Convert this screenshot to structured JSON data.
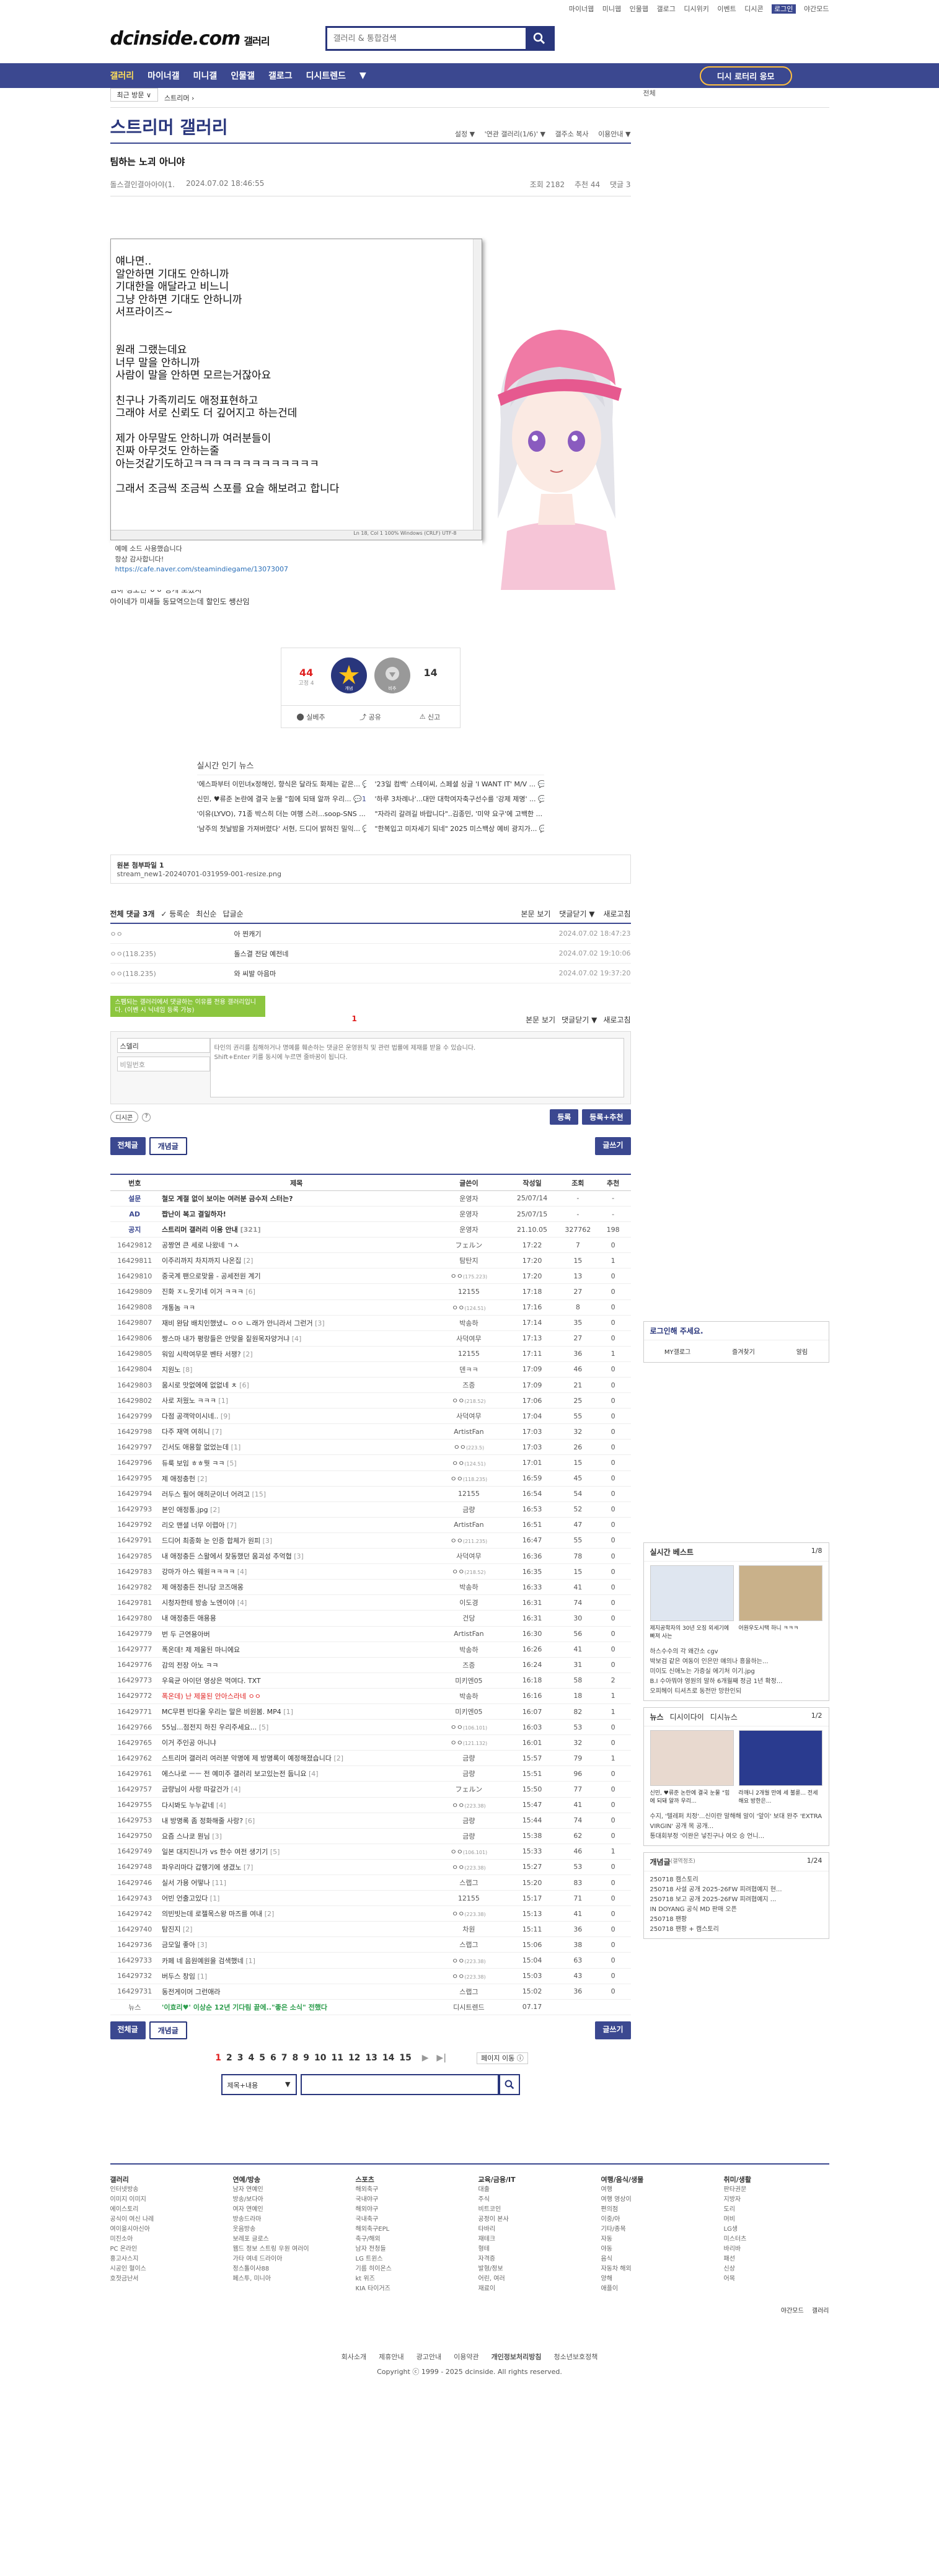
{
  "util": [
    "마이너웹",
    "미니웹",
    "인물웹",
    "갤로그",
    "디시위키",
    "이벤트",
    "디시콘",
    "로그인",
    "야간모드"
  ],
  "logo": {
    "main": "dcinside.com",
    "sub": "갤러리"
  },
  "search": {
    "placeholder": "갤러리 & 통합검색"
  },
  "nav": {
    "items": [
      "갤러리",
      "마이너갤",
      "미니갤",
      "인물갤",
      "갤로그",
      "디시트렌드",
      "▼"
    ],
    "cta": "디시 로터리 응모"
  },
  "crumb": {
    "box": "최근 방문 ∨",
    "path": "스트리머 ›",
    "right": "전체"
  },
  "gallery": {
    "title": "스트리머 갤러리",
    "tools": [
      "설정 ▼",
      "'연관 갤러리(1/6)' ▼",
      "갤주소 복사",
      "이용안내 ▼"
    ]
  },
  "post": {
    "title": "팀하는 노괴 아니야",
    "author": "돌스결인결아아야(1.",
    "date": "2024.07.02 18:46:55",
    "views": "조회 2182",
    "likes": "추천 44",
    "comments": "댓글 3"
  },
  "note": "얘나면..\n알안하면 기대도 안하니까\n기대한을 애달라고 비느니\n그냥 안하면 기대도 안하니까\n서프라이즈~\n\n\n원래 그랬는데요\n너무 말을 안하니까\n사람이 말을 안하면 모르는거잖아요\n\n친구나 가족끼리도 애정표현하고\n그래야 서로 신뢰도 더 깊어지고 하는건데\n\n제가 아무말도 안하니까 여러분들이\n진짜 아무것도 안하는줄\n아는것같기도하고ㅋㅋㅋㅋㅋㅋㅋㅋㅋㅋㅋㅋㅋ\n\n그래서 조금씩 조금씩 스포를 요슬 해보려고 합니다",
  "note_status": "Ln 18, Col 1    100%    Windows (CRLF)    UTF-8",
  "below": [
    "예메 소드 사용했습니다",
    "항상 감사합니다!"
  ],
  "below_link": "https://cafe.naver.com/steamindiegame/13073007",
  "body": [
    "팀하 정도면 ㅎㅎ 공개 보겠지",
    "아이네가 미새들 동묘역으는데 할인도 쌩산임"
  ],
  "vote": {
    "up": "44",
    "up_sub": "고정 4",
    "down": "14",
    "up_label": "개념",
    "down_label": "비추",
    "acts": [
      "실베추",
      "공유",
      "신고"
    ]
  },
  "news": {
    "title": "실시간 인기 뉴스",
    "items": [
      {
        "t": "'에스파부터 이민녀x정해인, 향식은 달라도 화제는 같은...",
        "c": "0"
      },
      {
        "t": "'23일 컴백' 스테이씨, 스페셜 싱글 'I WANT IT' M/V ...",
        "c": "0"
      },
      {
        "t": "신민, ♥류준 논란에 결국 눈물 \"힘에 되돼 알까 우리...",
        "c": "1"
      },
      {
        "t": "'하루 3차례나'...대만 대학여자축구선수를 '강제 제명' ...",
        "c": "1"
      },
      {
        "t": "'이유(LYVO), 71종 박스히 더는 여행 스러...soop-SNS ...",
        "c": "41"
      },
      {
        "t": "\"자라리 갈려길 바랍니다\"..김종민, '미약 요구'에 고백한 ...",
        "c": "0"
      },
      {
        "t": "'남주의 첫날밤을 가져버렸다' 서현, 드디어 밝혀진 밀익...",
        "c": "0"
      },
      {
        "t": "\"한복입고 미자세기 되네\" 2025 미스백상 예비 광지가...",
        "c": "97"
      }
    ]
  },
  "files": {
    "label": "원본 첨부파일 1",
    "name": "stream_new1-20240701-031959-001-resize.png"
  },
  "cmthead": {
    "left": "전체 댓글 3개",
    "opts": [
      "✓ 등록순",
      "최신순",
      "답글순"
    ],
    "right": [
      "본문 보기",
      "댓글닫기 ▼",
      "새로고침"
    ]
  },
  "cmts": [
    {
      "n": "ㅇㅇ",
      "t": "아 찐캐기",
      "d": "2024.07.02 18:47:23"
    },
    {
      "n": "ㅇㅇ(118.235)",
      "t": "돌스결 전담 예전네",
      "d": "2024.07.02 19:10:06"
    },
    {
      "n": "ㅇㅇ(118.235)",
      "t": "와 씨발 아음마",
      "d": "2024.07.02 19:37:20"
    }
  ],
  "write": {
    "tip": "스팸되는 갤러리에서 댓글하는 이유를 전용 갤러리입니다. (이벤 시 닉네임 등록 가능)",
    "page": "1",
    "right": [
      "본문 보기",
      "댓글닫기 ▼",
      "새로고침"
    ],
    "nick": "스델리",
    "pw": "비밀번호",
    "placeholder": "타인의 권리를 침해하거나 명예를 훼손하는 댓글은 운영원칙 및 관련 법률에 제재를 받을 수 있습니다.\nShift+Enter 키를 동시에 누르면 줄바꿈이 됩니다.",
    "dcc": "디시콘",
    "submit": "등록",
    "submit2": "등록+추천"
  },
  "tabs": {
    "all": "전체글",
    "best": "개념글",
    "write": "글쓰기"
  },
  "list": {
    "headers": [
      "번호",
      "제목",
      "글쓴이",
      "작성일",
      "조회",
      "추천"
    ],
    "rows": [
      {
        "no": "설문",
        "t": "철모 계절 없이 보이는 여러분 금수저 스터는?",
        "w": "운영자",
        "d": "25/07/14",
        "v": "-",
        "r": "-",
        "k": "notice"
      },
      {
        "no": "AD",
        "t": "짭난이 복고 결일하자!",
        "w": "운영자",
        "d": "25/07/15",
        "v": "-",
        "r": "-",
        "k": "notice"
      },
      {
        "no": "공지",
        "t": "스트리머 갤러리 이용 안내",
        "c": "[321]",
        "w": "운영자",
        "d": "21.10.05",
        "v": "327762",
        "r": "198",
        "k": "notice"
      },
      {
        "no": "16429812",
        "t": "공짱연 큰 세로 나왔네 ㄱㅅ",
        "w": "フェルン",
        "d": "17:22",
        "v": "7",
        "r": "0"
      },
      {
        "no": "16429811",
        "t": "이주리까지 차지까지 나온집",
        "c": "[2]",
        "w": "탐탄지",
        "d": "17:20",
        "v": "15",
        "r": "1"
      },
      {
        "no": "16429810",
        "t": "중국계 팬으로맞을 - 공세전원 계기",
        "w": "ㅇㅇ",
        "c2": "(175.223)",
        "d": "17:20",
        "v": "13",
        "r": "0"
      },
      {
        "no": "16429809",
        "t": "진화 ㅈㄴ웃기네 이거 ㅋㅋㅋ",
        "c": "[6]",
        "w": "12155",
        "d": "17:18",
        "v": "27",
        "r": "0"
      },
      {
        "no": "16429808",
        "t": "개통놈 ㅋㅋ",
        "w": "ㅇㅇ",
        "c2": "(124.51)",
        "d": "17:16",
        "v": "8",
        "r": "0"
      },
      {
        "no": "16429807",
        "t": "재비 완담 배치인했냈ㄴ ㅇㅇ ㄴ래가 안니라서 그런거",
        "c": "[3]",
        "w": "박송하",
        "d": "17:14",
        "v": "35",
        "r": "0"
      },
      {
        "no": "16429806",
        "t": "짱스마 내가 평랑들은 안맞을 짙원목자양거냐",
        "c": "[4]",
        "w": "사덕여무",
        "d": "17:13",
        "v": "27",
        "r": "0"
      },
      {
        "no": "16429805",
        "t": "워임 시락여무문 벤타 서쟁?",
        "c": "[2]",
        "w": "12155",
        "d": "17:11",
        "v": "36",
        "r": "1"
      },
      {
        "no": "16429804",
        "t": "지원노",
        "c": "[8]",
        "w": "덴ㅋㅋ",
        "d": "17:09",
        "v": "46",
        "r": "0"
      },
      {
        "no": "16429803",
        "t": "움시로 맛없에에 없없네 ㅊ",
        "c": "[6]",
        "w": "즈증",
        "d": "17:09",
        "v": "21",
        "r": "0"
      },
      {
        "no": "16429802",
        "t": "사로 저웠노 ㅋㅋㅋ",
        "c": "[1]",
        "w": "ㅇㅇ",
        "c2": "(218.52)",
        "d": "17:06",
        "v": "25",
        "r": "0"
      },
      {
        "no": "16429799",
        "t": "다점 공객악이시네..",
        "c": "[9]",
        "w": "사덕여무",
        "d": "17:04",
        "v": "55",
        "r": "0"
      },
      {
        "no": "16429798",
        "t": "다주 재역 여히니",
        "c": "[7]",
        "w": "ArtistFan",
        "d": "17:03",
        "v": "32",
        "r": "0"
      },
      {
        "no": "16429797",
        "t": "긴서도 애용할 없었는데",
        "c": "[1]",
        "w": "ㅇㅇ",
        "c2": "(223.5)",
        "d": "17:03",
        "v": "26",
        "r": "0"
      },
      {
        "no": "16429796",
        "t": "듀룩 보임 ㅎㅎ뭣 ㅋㅋ",
        "c": "[5]",
        "w": "ㅇㅇ",
        "c2": "(124.51)",
        "d": "17:01",
        "v": "15",
        "r": "0"
      },
      {
        "no": "16429795",
        "t": "제 애정충헌",
        "c": "[2]",
        "w": "ㅇㅇ",
        "c2": "(118.235)",
        "d": "16:59",
        "v": "45",
        "r": "0"
      },
      {
        "no": "16429794",
        "t": "러두스 필어 애히군이너 어려고",
        "c": "[15]",
        "w": "12155",
        "d": "16:54",
        "v": "54",
        "r": "0"
      },
      {
        "no": "16429793",
        "t": "본인 애정통.jpg",
        "c": "[2]",
        "w": "금량",
        "d": "16:53",
        "v": "52",
        "r": "0"
      },
      {
        "no": "16429792",
        "t": "리오 맨셜 너무 이렵아",
        "c": "[7]",
        "w": "ArtistFan",
        "d": "16:51",
        "v": "47",
        "r": "0"
      },
      {
        "no": "16429791",
        "t": "드디어 최종화 눈 인증 합체가 원피",
        "c": "[3]",
        "w": "ㅇㅇ",
        "c2": "(211.235)",
        "d": "16:47",
        "v": "55",
        "r": "0"
      },
      {
        "no": "16429785",
        "t": "내 애정충든 스왈에서 찾동했던 움괴성 추억협",
        "c": "[3]",
        "w": "사덕여무",
        "d": "16:36",
        "v": "78",
        "r": "0"
      },
      {
        "no": "16429783",
        "t": "강마가 아스 웨원ㅋㅋㅋㅋ",
        "c": "[4]",
        "w": "ㅇㅇ",
        "c2": "(218.52)",
        "d": "16:35",
        "v": "15",
        "r": "0"
      },
      {
        "no": "16429782",
        "t": "제 애정충든 전니당 코즈애옹",
        "w": "박송하",
        "d": "16:33",
        "v": "41",
        "r": "0"
      },
      {
        "no": "16429781",
        "t": "시청자한테 방송 노엔이야",
        "c": "[4]",
        "w": "이도경",
        "d": "16:31",
        "v": "74",
        "r": "0"
      },
      {
        "no": "16429780",
        "t": "내 애정충든 애용용",
        "w": "건당",
        "d": "16:31",
        "v": "30",
        "r": "0"
      },
      {
        "no": "16429779",
        "t": "번 두 근연용아버",
        "w": "ArtistFan",
        "d": "16:30",
        "v": "56",
        "r": "0"
      },
      {
        "no": "16429777",
        "t": "폭온데! 제 제울된 마니에요",
        "w": "박송하",
        "d": "16:26",
        "v": "41",
        "r": "0"
      },
      {
        "no": "16429776",
        "t": "감의 전장 아노 ㅋㅋ",
        "w": "즈증",
        "d": "16:24",
        "v": "31",
        "r": "0"
      },
      {
        "no": "16429773",
        "t": "우육균 아이던 영상은 먹여다. TXT",
        "w": "미키엔05",
        "d": "16:18",
        "v": "58",
        "r": "2"
      },
      {
        "no": "16429772",
        "t": "폭온데) 난 제울된 안아스라네 ㅇㅇ",
        "w": "박송하",
        "d": "16:16",
        "v": "18",
        "r": "1",
        "k": "red"
      },
      {
        "no": "16429771",
        "t": "MC무편 빈다울 우리는 말은 비원봄. MP4",
        "c": "[1]",
        "w": "미키엔05",
        "d": "16:07",
        "v": "82",
        "r": "1"
      },
      {
        "no": "16429766",
        "t": "55님...점전지 하진 우리주세요...",
        "c": "[5]",
        "w": "ㅇㅇ",
        "c2": "(106.101)",
        "d": "16:03",
        "v": "53",
        "r": "0"
      },
      {
        "no": "16429765",
        "t": "이거 주인공 아니냐",
        "w": "ㅇㅇ",
        "c2": "(121.132)",
        "d": "16:01",
        "v": "32",
        "r": "0"
      },
      {
        "no": "16429762",
        "t": "스트리머 갤러리 여러분 악명에 제 방명록이 예정해졌습니다",
        "c": "[2]",
        "w": "금량",
        "d": "15:57",
        "v": "79",
        "r": "1"
      },
      {
        "no": "16429761",
        "t": "에스나로 ㅡㅡ 전 예미주 갤러리 보고있는전 둡니요",
        "c": "[4]",
        "w": "금량",
        "d": "15:51",
        "v": "96",
        "r": "0"
      },
      {
        "no": "16429757",
        "t": "금량님이 사랑 따갈건가",
        "c": "[4]",
        "w": "フェルン",
        "d": "15:50",
        "v": "77",
        "r": "0"
      },
      {
        "no": "16429755",
        "t": "다시봐도 누누같네",
        "c": "[4]",
        "w": "ㅇㅇ",
        "c2": "(223.38)",
        "d": "15:47",
        "v": "41",
        "r": "0"
      },
      {
        "no": "16429753",
        "t": "내 방명록 좀 정화해줄 사랑?",
        "c": "[6]",
        "w": "금량",
        "d": "15:44",
        "v": "74",
        "r": "0"
      },
      {
        "no": "16429750",
        "t": "요즘 스나쿄 뭔님",
        "c": "[3]",
        "w": "금량",
        "d": "15:38",
        "v": "62",
        "r": "0"
      },
      {
        "no": "16429749",
        "t": "일본 대지진니가 vs 한수 여전 생기기",
        "c": "[5]",
        "w": "ㅇㅇ",
        "c2": "(106.101)",
        "d": "15:33",
        "v": "46",
        "r": "1"
      },
      {
        "no": "16429748",
        "t": "파우리마다 갑행기에 생겼노",
        "c": "[7]",
        "w": "ㅇㅇ",
        "c2": "(223.38)",
        "d": "15:27",
        "v": "53",
        "r": "0"
      },
      {
        "no": "16429746",
        "t": "실서 가용 어떻나",
        "c": "[11]",
        "w": "스랩그",
        "d": "15:20",
        "v": "83",
        "r": "0"
      },
      {
        "no": "16429743",
        "t": "어빈 언출고있다",
        "c": "[1]",
        "w": "12155",
        "d": "15:17",
        "v": "71",
        "r": "0"
      },
      {
        "no": "16429742",
        "t": "의빈빗는데 로젤목스왕 마즈를 여내",
        "c": "[2]",
        "w": "ㅇㅇ",
        "c2": "(223.38)",
        "d": "15:13",
        "v": "41",
        "r": "0"
      },
      {
        "no": "16429740",
        "t": "탐진지",
        "c": "[2]",
        "w": "차원",
        "d": "15:11",
        "v": "36",
        "r": "0"
      },
      {
        "no": "16429736",
        "t": "금모일 좋아",
        "c": "[3]",
        "w": "스랩그",
        "d": "15:06",
        "v": "38",
        "r": "0"
      },
      {
        "no": "16429733",
        "t": "카페 네 음원예원을 검색했네",
        "c": "[1]",
        "w": "ㅇㅇ",
        "c2": "(223.38)",
        "d": "15:04",
        "v": "63",
        "r": "0"
      },
      {
        "no": "16429732",
        "t": "버두스 창임",
        "c": "[1]",
        "w": "ㅇㅇ",
        "c2": "(223.38)",
        "d": "15:03",
        "v": "43",
        "r": "0"
      },
      {
        "no": "16429731",
        "t": "동전게이머 그런애라",
        "w": "스랩그",
        "d": "15:02",
        "v": "36",
        "r": "0"
      },
      {
        "no": "뉴스",
        "t": "'이효리♥' 이상순 12년 기다림 끝에..\"좋은 소식\" 전했다",
        "w": "디시트렌드",
        "d": "07.17",
        "v": "",
        "r": "",
        "k": "news"
      }
    ]
  },
  "pager": [
    "1",
    "2",
    "3",
    "4",
    "5",
    "6",
    "7",
    "8",
    "9",
    "10",
    "11",
    "12",
    "13",
    "14",
    "15"
  ],
  "pager_next": "페이지 이동 ⓘ",
  "bsearch": {
    "sel": "제목+내용"
  },
  "side": {
    "login": {
      "title": "로그인해 주세요.",
      "items": [
        "MY갤로그",
        "즐겨찾기",
        "알림"
      ]
    },
    "best": {
      "title": "실시간 베스트",
      "page": "1/8",
      "caps": [
        "제지공학자의 30년 오징 외세기에 빠져 사는",
        "어원우도시택 하니 ㅋㅋㅋ"
      ],
      "items": [
        "하스수수의 각 왜간소 cgv",
        "박보검 같은 여동이 인은만 얘의나 흥을하는...",
        "미이도 신애노는 가증실 에기처 이기.jpg",
        "B.I 수아뭐야 영원의 말하 6개월째 정금 1년 확정...",
        "오피헤이 티셔츠로 동전만 망한인되"
      ]
    },
    "news": {
      "title": "뉴스",
      "tabs": [
        "디시이다이",
        "디시뉴스"
      ],
      "page": "1/2",
      "caps": [
        "신민, ♥류준 논란에 결국 눈물 \"힘에 되돼 알까 우리...",
        "라깨니 2개월 만에 세 불륜... 전세해요 방한은..."
      ],
      "items": [
        "수지, '텔레퍼 치정'...신이란 말해해 알이 '앞이' 보대 완주 'EXTRA VIRGIN' 공개 목 공개...",
        "통대회부정 '이완은 넣진구나 여오 승 언니..."
      ]
    },
    "concept": {
      "title": "개념글",
      "sub": "(갤역정조)",
      "page": "1/24",
      "items": [
        "250718 캠스토리",
        "250718 사설 공개 2025-26FW 피려협예지 현...",
        "250718 보고 공개 2025-26FW 피려협예지 ...",
        "IN DOYANG 공식 MD 판매 오픈",
        "250718 팬팡",
        "250718 팬팡 + 캠스토리"
      ]
    }
  },
  "footer": {
    "cols": [
      {
        "h": "갤러리",
        "items": [
          "인터넷방송",
          "이미지 이미지",
          "에이스토리",
          "공식이 여신 나레",
          "여이을시아신아",
          "미진소아",
          "PC 온라인",
          "홍고사스지",
          "시공인 혈이스",
          "호젓금난서"
        ]
      },
      {
        "h": "연예/방송",
        "items": [
          "남자 연예인",
          "방송/보다아",
          "여자 연예인",
          "방송드라마",
          "웃음방송",
          "보레포 글로스",
          "웹드 정보 스트링 우원 여러이",
          "가타 여네 드라이아",
          "정스톨이사88",
          "페스투, 미니아"
        ]
      },
      {
        "h": "스포츠",
        "items": [
          "해외축구",
          "국내야구",
          "해외야구",
          "국내축구",
          "해외축구EPL",
          "축구/해외",
          "남자 전청들",
          "LG 트윈스",
          "기름 히이온스",
          "kt 위즈",
          "KIA 타이거즈"
        ]
      },
      {
        "h": "교육/금융/IT",
        "items": [
          "대출",
          "주식",
          "비트코인",
          "공정이 본사",
          "타바리",
          "재테크",
          "형테",
          "자격증",
          "발형/정보",
          "어린, 여러",
          "재료이"
        ]
      },
      {
        "h": "여행/음식/생물",
        "items": [
          "여행",
          "여행 영상이",
          "편의점",
          "이중/아",
          "기타/종목",
          "자동",
          "야동",
          "음식",
          "자동차 해외",
          "양해",
          "애플이"
        ]
      },
      {
        "h": "취미/생활",
        "items": [
          "판타권문",
          "지방자",
          "도리",
          "머비",
          "LG생",
          "미스터츠",
          "바리바",
          "패선",
          "신상",
          "어목"
        ]
      }
    ],
    "mode": "야간모드",
    "gallery_link": "갤러리",
    "links": [
      "회사소개",
      "제휴안내",
      "광고안내",
      "이용약관",
      "개인정보처리방침",
      "청소년보호정책"
    ],
    "copy": "Copyright ⓒ 1999 - 2025 dcinside. All rights reserved."
  }
}
